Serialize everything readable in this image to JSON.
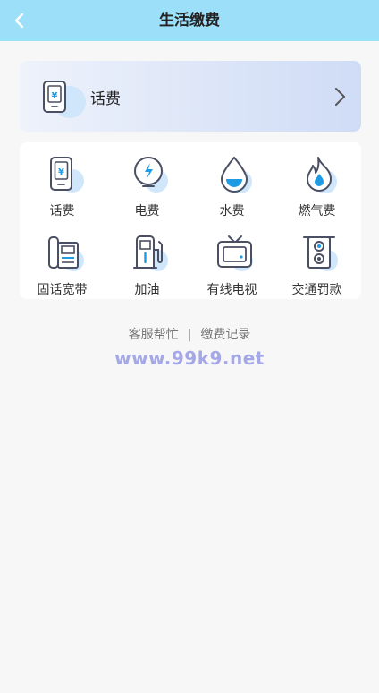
{
  "header": {
    "title": "生活缴费",
    "back_icon": "chevron-left-icon"
  },
  "featured": {
    "label": "话费",
    "icon": "phone-bill-icon"
  },
  "services": [
    {
      "label": "话费",
      "icon": "phone-bill-icon"
    },
    {
      "label": "电费",
      "icon": "electricity-icon"
    },
    {
      "label": "水费",
      "icon": "water-drop-icon"
    },
    {
      "label": "燃气费",
      "icon": "gas-flame-icon"
    },
    {
      "label": "固话宽带",
      "icon": "landline-icon"
    },
    {
      "label": "加油",
      "icon": "fuel-pump-icon"
    },
    {
      "label": "有线电视",
      "icon": "tv-icon"
    },
    {
      "label": "交通罚款",
      "icon": "traffic-light-icon"
    }
  ],
  "footer_links": {
    "service": "客服帮忙",
    "separator": "|",
    "records": "缴费记录"
  },
  "watermark": "www.99k9.net",
  "colors": {
    "header": "#9bdff8",
    "icon_stroke": "#4a4f63",
    "icon_accent": "#1f9be3",
    "icon_bubble": "#cfe6fb"
  }
}
